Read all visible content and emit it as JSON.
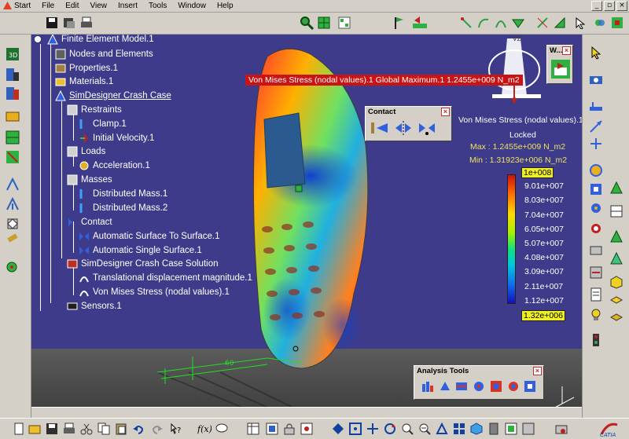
{
  "menu": {
    "items": [
      "Start",
      "File",
      "Edit",
      "View",
      "Insert",
      "Tools",
      "Window",
      "Help"
    ]
  },
  "tree": {
    "nodes": [
      {
        "label": "Finite Element Model.1",
        "underline": false
      },
      {
        "label": "Nodes and Elements",
        "underline": false
      },
      {
        "label": "Properties.1",
        "underline": false
      },
      {
        "label": "Materials.1",
        "underline": false
      },
      {
        "label": "SimDesigner Crash Case",
        "underline": true
      },
      {
        "label": "Restraints",
        "underline": false
      },
      {
        "label": "Clamp.1",
        "underline": false
      },
      {
        "label": "Initial Velocity.1",
        "underline": false
      },
      {
        "label": "Loads",
        "underline": false
      },
      {
        "label": "Acceleration.1",
        "underline": false
      },
      {
        "label": "Masses",
        "underline": false
      },
      {
        "label": "Distributed Mass.1",
        "underline": false
      },
      {
        "label": "Distributed Mass.2",
        "underline": false
      },
      {
        "label": "Contact",
        "underline": false
      },
      {
        "label": "Automatic Surface To Surface.1",
        "underline": false
      },
      {
        "label": "Automatic Single Surface.1",
        "underline": false
      },
      {
        "label": "SimDesigner Crash Case Solution",
        "underline": false
      },
      {
        "label": "Translational displacement magnitude.1",
        "underline": false
      },
      {
        "label": "Von Mises Stress (nodal values).1",
        "underline": false
      },
      {
        "label": "Sensors.1",
        "underline": false
      }
    ]
  },
  "result_banner": "Von Mises Stress (nodal values).1  Global Maximum.1  1.2455e+009 N_m2",
  "legend": {
    "title": "Von Mises Stress (nodal values).1",
    "status": "Locked",
    "max": "Max : 1.2455e+009 N_m2",
    "min": "Min : 1.31923e+006 N_m2",
    "values": [
      "1e+008",
      "9.01e+007",
      "8.03e+007",
      "7.04e+007",
      "6.05e+007",
      "5.07e+007",
      "4.08e+007",
      "3.09e+007",
      "2.11e+007",
      "1.12e+007",
      "1.32e+006"
    ]
  },
  "panels": {
    "contact_title": "Contact",
    "analysis_title": "Analysis Tools",
    "w_title": "W..."
  },
  "viewport": {
    "dim_label": "60"
  },
  "compass": {
    "label": "VZ"
  },
  "colors": {
    "viewport_bg": "#3e3c8a",
    "banner_bg": "#c81414",
    "legend_extreme": "#f0e060"
  }
}
